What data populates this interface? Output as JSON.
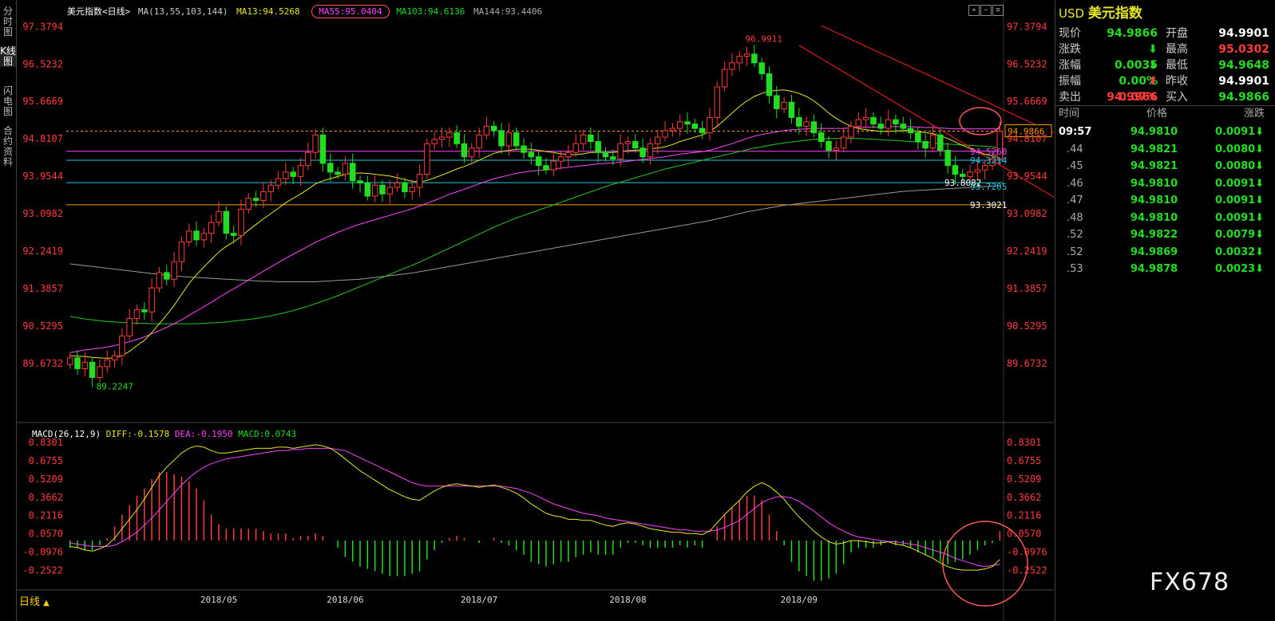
{
  "sidebar": [
    {
      "label": "分时图",
      "active": false
    },
    {
      "label": "K线图",
      "active": true
    },
    {
      "label": "闪电图",
      "active": false
    },
    {
      "label": "合约资料",
      "active": false
    }
  ],
  "header": {
    "name": "美元指数<日线>",
    "ma_params": "MA(13,55,103,144)",
    "ma13": "MA13:94.5268",
    "ma55": "MA55:95.0404",
    "ma103": "MA103:94.6136",
    "ma144": "MA144:93.4406"
  },
  "macd_header": {
    "params": "MACD(26,12,9)",
    "diff": "DIFF:-0.1578",
    "dea": "DEA:-0.1950",
    "macd": "MACD:0.0743"
  },
  "period_label": "日线",
  "watermark": "FX678",
  "colors": {
    "up": "#ff3b3b",
    "down": "#22dd22",
    "ma13": "#e8e820",
    "ma55": "#ff44ff",
    "ma103": "#22cc22",
    "ma144": "#999999",
    "axis": "#ff3b3b",
    "cyan": "#20c8e0"
  },
  "chart_data": [
    {
      "type": "candlestick",
      "title": "美元指数<日线>",
      "y_ticks": [
        "97.3794",
        "96.5232",
        "95.6669",
        "94.8107",
        "93.9544",
        "93.0982",
        "92.2419",
        "91.3857",
        "90.5295",
        "89.6732"
      ],
      "y_range": [
        89.05,
        97.55
      ],
      "x_ticks": [
        "2018/05",
        "2018/06",
        "2018/07",
        "2018/08",
        "2018/09"
      ],
      "high_label": "96.9911",
      "low_label": "89.2247",
      "price_tag": "94.9866",
      "level_labels": [
        {
          "text": "94.5260",
          "value": 94.526,
          "color": "#ff44ff"
        },
        {
          "text": "94.3214",
          "value": 94.3214,
          "color": "#20c8e0"
        },
        {
          "text": "93.7205",
          "value": 93.7205,
          "color": "#20c8e0"
        },
        {
          "text": "93.8082",
          "value": 93.8082,
          "color": "#ffffff"
        },
        {
          "text": "93.3021",
          "value": 93.3021,
          "color": "#ffffff"
        }
      ],
      "horizontal_lines": [
        {
          "value": 94.9866,
          "color": "#ff9900",
          "dashed": true
        },
        {
          "value": 94.526,
          "color": "#ff44ff",
          "dashed": false
        },
        {
          "value": 94.3214,
          "color": "#20c8e0",
          "dashed": false
        },
        {
          "value": 93.8082,
          "color": "#20c8e0",
          "dashed": false
        },
        {
          "value": 93.3021,
          "color": "#ff9900",
          "dashed": false
        }
      ],
      "closes": [
        89.8,
        89.55,
        89.7,
        89.35,
        89.6,
        89.75,
        89.85,
        90.3,
        90.7,
        90.9,
        90.85,
        91.4,
        91.75,
        91.6,
        92.0,
        92.45,
        92.7,
        92.5,
        92.65,
        92.9,
        93.15,
        92.65,
        92.6,
        93.2,
        93.45,
        93.4,
        93.6,
        93.75,
        93.9,
        94.05,
        93.95,
        94.2,
        94.5,
        94.9,
        94.25,
        94.05,
        94.0,
        94.25,
        93.85,
        93.8,
        93.5,
        93.75,
        93.55,
        93.7,
        93.8,
        93.6,
        93.7,
        94.0,
        94.7,
        94.8,
        94.85,
        94.95,
        94.7,
        94.4,
        94.6,
        94.9,
        95.1,
        95.0,
        94.65,
        94.95,
        94.65,
        94.5,
        94.4,
        94.2,
        94.1,
        94.3,
        94.4,
        94.5,
        94.7,
        94.9,
        94.75,
        94.5,
        94.4,
        94.35,
        94.7,
        94.75,
        94.6,
        94.4,
        94.7,
        94.85,
        95.0,
        95.05,
        95.2,
        95.15,
        95.05,
        94.95,
        95.3,
        96.0,
        96.4,
        96.55,
        96.7,
        96.75,
        96.55,
        96.3,
        95.8,
        95.5,
        95.65,
        95.3,
        95.1,
        95.2,
        94.95,
        94.75,
        94.55,
        94.6,
        94.85,
        95.1,
        95.25,
        95.3,
        95.15,
        95.05,
        95.25,
        95.15,
        95.05,
        94.95,
        94.75,
        94.6,
        94.9,
        94.55,
        94.2,
        94.0,
        93.95,
        94.05,
        94.1,
        94.2,
        94.35,
        94.9866
      ],
      "ma13": [
        89.85,
        89.84,
        89.83,
        89.81,
        89.8,
        89.79,
        89.8,
        89.85,
        89.95,
        90.08,
        90.2,
        90.38,
        90.58,
        90.78,
        91.0,
        91.25,
        91.5,
        91.7,
        91.88,
        92.05,
        92.22,
        92.35,
        92.45,
        92.58,
        92.72,
        92.85,
        92.98,
        93.1,
        93.22,
        93.35,
        93.45,
        93.55,
        93.66,
        93.78,
        93.85,
        93.9,
        93.95,
        94.0,
        94.02,
        94.03,
        94.02,
        94.0,
        93.98,
        93.96,
        93.92,
        93.88,
        93.84,
        93.82,
        93.86,
        93.92,
        93.98,
        94.05,
        94.12,
        94.18,
        94.25,
        94.32,
        94.4,
        94.48,
        94.52,
        94.55,
        94.57,
        94.58,
        94.57,
        94.55,
        94.52,
        94.5,
        94.47,
        94.45,
        94.45,
        94.47,
        94.5,
        94.5,
        94.5,
        94.5,
        94.52,
        94.54,
        94.55,
        94.56,
        94.58,
        94.6,
        94.63,
        94.68,
        94.75,
        94.8,
        94.85,
        94.9,
        94.98,
        95.1,
        95.25,
        95.4,
        95.55,
        95.68,
        95.78,
        95.85,
        95.9,
        95.92,
        95.93,
        95.9,
        95.85,
        95.78,
        95.68,
        95.55,
        95.4,
        95.28,
        95.18,
        95.1,
        95.05,
        95.02,
        95.0,
        94.98,
        94.98,
        94.99,
        95.0,
        95.0,
        94.98,
        94.95,
        94.93,
        94.88,
        94.82,
        94.74,
        94.66,
        94.59,
        94.52,
        94.46,
        94.42,
        94.4
      ],
      "ma55": [
        89.92,
        89.95,
        89.98,
        90.0,
        90.02,
        90.05,
        90.08,
        90.12,
        90.17,
        90.22,
        90.28,
        90.35,
        90.42,
        90.5,
        90.58,
        90.67,
        90.77,
        90.87,
        90.97,
        91.07,
        91.18,
        91.28,
        91.38,
        91.48,
        91.58,
        91.68,
        91.78,
        91.88,
        91.98,
        92.08,
        92.17,
        92.26,
        92.35,
        92.44,
        92.52,
        92.6,
        92.67,
        92.74,
        92.8,
        92.86,
        92.91,
        92.96,
        93.01,
        93.06,
        93.11,
        93.16,
        93.21,
        93.27,
        93.34,
        93.4,
        93.47,
        93.54,
        93.6,
        93.66,
        93.72,
        93.78,
        93.84,
        93.9,
        93.94,
        93.98,
        94.02,
        94.05,
        94.07,
        94.09,
        94.1,
        94.12,
        94.14,
        94.16,
        94.18,
        94.2,
        94.22,
        94.24,
        94.25,
        94.26,
        94.28,
        94.3,
        94.32,
        94.34,
        94.36,
        94.38,
        94.4,
        94.43,
        94.46,
        94.48,
        94.5,
        94.52,
        94.55,
        94.6,
        94.65,
        94.7,
        94.76,
        94.82,
        94.87,
        94.91,
        94.94,
        94.97,
        95.0,
        95.02,
        95.03,
        95.04,
        95.05,
        95.05,
        95.05,
        95.05,
        95.05,
        95.06,
        95.07,
        95.08,
        95.08,
        95.08,
        95.09,
        95.09,
        95.09,
        95.09,
        95.08,
        95.07,
        95.07,
        95.06,
        95.05,
        95.04,
        95.04,
        95.04,
        95.04,
        95.04,
        95.04,
        95.04
      ],
      "ma103": [
        90.75,
        90.72,
        90.69,
        90.67,
        90.65,
        90.63,
        90.62,
        90.61,
        90.6,
        90.59,
        90.59,
        90.58,
        90.58,
        90.58,
        90.58,
        90.58,
        90.58,
        90.58,
        90.59,
        90.6,
        90.61,
        90.62,
        90.64,
        90.66,
        90.68,
        90.7,
        90.73,
        90.76,
        90.8,
        90.84,
        90.88,
        90.93,
        90.98,
        91.04,
        91.1,
        91.16,
        91.22,
        91.29,
        91.36,
        91.43,
        91.5,
        91.57,
        91.64,
        91.71,
        91.78,
        91.85,
        91.92,
        91.99,
        92.07,
        92.15,
        92.23,
        92.31,
        92.39,
        92.47,
        92.55,
        92.63,
        92.71,
        92.79,
        92.86,
        92.93,
        93.0,
        93.06,
        93.12,
        93.18,
        93.24,
        93.3,
        93.36,
        93.42,
        93.48,
        93.54,
        93.6,
        93.66,
        93.72,
        93.77,
        93.82,
        93.87,
        93.92,
        93.97,
        94.02,
        94.07,
        94.12,
        94.16,
        94.2,
        94.24,
        94.28,
        94.32,
        94.36,
        94.4,
        94.44,
        94.48,
        94.52,
        94.56,
        94.6,
        94.63,
        94.66,
        94.69,
        94.72,
        94.74,
        94.76,
        94.78,
        94.8,
        94.81,
        94.82,
        94.82,
        94.82,
        94.82,
        94.82,
        94.81,
        94.8,
        94.79,
        94.78,
        94.77,
        94.76,
        94.75,
        94.74,
        94.73,
        94.72,
        94.7,
        94.69,
        94.68,
        94.67,
        94.66,
        94.65,
        94.64,
        94.63,
        94.61
      ],
      "ma144": [
        91.95,
        91.93,
        91.91,
        91.89,
        91.87,
        91.85,
        91.83,
        91.81,
        91.79,
        91.77,
        91.75,
        91.73,
        91.71,
        91.69,
        91.67,
        91.66,
        91.65,
        91.64,
        91.63,
        91.62,
        91.61,
        91.6,
        91.59,
        91.58,
        91.57,
        91.56,
        91.55,
        91.55,
        91.54,
        91.54,
        91.54,
        91.54,
        91.54,
        91.54,
        91.55,
        91.56,
        91.57,
        91.58,
        91.59,
        91.6,
        91.62,
        91.64,
        91.66,
        91.68,
        91.7,
        91.72,
        91.74,
        91.77,
        91.8,
        91.83,
        91.86,
        91.89,
        91.92,
        91.95,
        91.98,
        92.01,
        92.04,
        92.07,
        92.1,
        92.13,
        92.16,
        92.19,
        92.22,
        92.25,
        92.28,
        92.31,
        92.34,
        92.37,
        92.4,
        92.43,
        92.46,
        92.49,
        92.52,
        92.55,
        92.58,
        92.61,
        92.64,
        92.67,
        92.7,
        92.73,
        92.76,
        92.79,
        92.82,
        92.85,
        92.88,
        92.91,
        92.94,
        92.98,
        93.02,
        93.06,
        93.1,
        93.14,
        93.17,
        93.2,
        93.23,
        93.26,
        93.29,
        93.31,
        93.33,
        93.35,
        93.37,
        93.39,
        93.41,
        93.43,
        93.45,
        93.47,
        93.49,
        93.51,
        93.53,
        93.55,
        93.57,
        93.59,
        93.61,
        93.62,
        93.63,
        93.64,
        93.65,
        93.66,
        93.67,
        93.68,
        93.69,
        93.7,
        93.71,
        93.72,
        93.73,
        93.74
      ],
      "trend_channel": [
        {
          "from": [
            96.95,
            98
          ],
          "to": [
            93.1,
            136
          ]
        },
        {
          "from": [
            97.4,
            101
          ],
          "to": [
            94.65,
            136
          ]
        }
      ]
    },
    {
      "type": "macd",
      "title": "MACD(26,12,9)",
      "y_ticks": [
        "0.8301",
        "0.6755",
        "0.5209",
        "0.3662",
        "0.2116",
        "0.0570",
        "-0.0976",
        "-0.2522"
      ],
      "y_range": [
        -0.33,
        0.85
      ],
      "diff": [
        -0.05,
        -0.06,
        -0.08,
        -0.09,
        -0.07,
        -0.04,
        0.02,
        0.1,
        0.18,
        0.26,
        0.35,
        0.45,
        0.55,
        0.62,
        0.68,
        0.74,
        0.78,
        0.8,
        0.79,
        0.76,
        0.74,
        0.74,
        0.75,
        0.76,
        0.77,
        0.78,
        0.78,
        0.78,
        0.79,
        0.79,
        0.78,
        0.79,
        0.8,
        0.81,
        0.8,
        0.78,
        0.74,
        0.69,
        0.64,
        0.59,
        0.55,
        0.51,
        0.47,
        0.43,
        0.4,
        0.37,
        0.35,
        0.34,
        0.38,
        0.42,
        0.45,
        0.47,
        0.48,
        0.47,
        0.46,
        0.45,
        0.46,
        0.47,
        0.45,
        0.43,
        0.4,
        0.36,
        0.31,
        0.27,
        0.23,
        0.21,
        0.2,
        0.18,
        0.18,
        0.17,
        0.17,
        0.15,
        0.13,
        0.12,
        0.14,
        0.15,
        0.14,
        0.12,
        0.1,
        0.09,
        0.08,
        0.07,
        0.07,
        0.06,
        0.06,
        0.05,
        0.08,
        0.15,
        0.22,
        0.28,
        0.34,
        0.41,
        0.46,
        0.49,
        0.46,
        0.41,
        0.35,
        0.27,
        0.2,
        0.14,
        0.08,
        0.03,
        -0.01,
        -0.03,
        -0.02,
        0.0,
        0.0,
        -0.01,
        -0.02,
        -0.02,
        -0.01,
        -0.03,
        -0.04,
        -0.06,
        -0.09,
        -0.12,
        -0.15,
        -0.19,
        -0.22,
        -0.24,
        -0.25,
        -0.25,
        -0.25,
        -0.24,
        -0.22,
        -0.16
      ],
      "dea": [
        -0.02,
        -0.03,
        -0.04,
        -0.05,
        -0.05,
        -0.05,
        -0.04,
        -0.01,
        0.03,
        0.07,
        0.13,
        0.19,
        0.26,
        0.33,
        0.4,
        0.47,
        0.53,
        0.58,
        0.62,
        0.65,
        0.67,
        0.69,
        0.7,
        0.71,
        0.72,
        0.73,
        0.74,
        0.75,
        0.76,
        0.76,
        0.77,
        0.77,
        0.78,
        0.78,
        0.78,
        0.78,
        0.77,
        0.76,
        0.73,
        0.7,
        0.67,
        0.64,
        0.61,
        0.58,
        0.55,
        0.52,
        0.49,
        0.47,
        0.46,
        0.46,
        0.46,
        0.46,
        0.46,
        0.46,
        0.46,
        0.46,
        0.46,
        0.46,
        0.46,
        0.45,
        0.44,
        0.42,
        0.4,
        0.37,
        0.34,
        0.31,
        0.29,
        0.27,
        0.25,
        0.23,
        0.22,
        0.21,
        0.19,
        0.18,
        0.17,
        0.16,
        0.15,
        0.14,
        0.13,
        0.12,
        0.11,
        0.1,
        0.09,
        0.09,
        0.08,
        0.08,
        0.08,
        0.09,
        0.11,
        0.14,
        0.17,
        0.22,
        0.27,
        0.32,
        0.35,
        0.37,
        0.37,
        0.36,
        0.33,
        0.29,
        0.25,
        0.2,
        0.15,
        0.11,
        0.08,
        0.05,
        0.03,
        0.02,
        0.01,
        0.0,
        -0.01,
        -0.01,
        -0.02,
        -0.03,
        -0.04,
        -0.06,
        -0.08,
        -0.1,
        -0.12,
        -0.15,
        -0.17,
        -0.19,
        -0.21,
        -0.22,
        -0.21,
        -0.2
      ]
    }
  ],
  "quote": {
    "currency": "USD",
    "name": "美元指数",
    "rows": [
      {
        "k1": "现价",
        "v1": "94.9866",
        "c1": "dn",
        "k2": "开盘",
        "v2": "94.9901",
        "c2": "wt"
      },
      {
        "k1": "涨跌",
        "v1": "0.0035",
        "c1": "dn",
        "a1": "down",
        "k2": "最高",
        "v2": "95.0302",
        "c2": "up"
      },
      {
        "k1": "涨幅",
        "v1": "0.00%",
        "c1": "dn",
        "a1": "down",
        "k2": "最低",
        "v2": "94.9648",
        "c2": "dn"
      },
      {
        "k1": "振幅",
        "v1": "0.07%",
        "c1": "up",
        "a1": "up",
        "k2": "昨收",
        "v2": "94.9901",
        "c2": "wt"
      },
      {
        "k1": "卖出",
        "v1": "94.9966",
        "c1": "up",
        "k2": "买入",
        "v2": "94.9866",
        "c2": "dn"
      }
    ],
    "tick_headers": [
      "时间",
      "价格",
      "涨跌"
    ],
    "ticks": [
      {
        "time": "09:57",
        "price": "94.9810",
        "chg": "0.0091"
      },
      {
        "time": ".44",
        "price": "94.9821",
        "chg": "0.0080"
      },
      {
        "time": ".45",
        "price": "94.9821",
        "chg": "0.0080"
      },
      {
        "time": ".46",
        "price": "94.9810",
        "chg": "0.0091"
      },
      {
        "time": ".47",
        "price": "94.9810",
        "chg": "0.0091"
      },
      {
        "time": ".48",
        "price": "94.9810",
        "chg": "0.0091"
      },
      {
        "time": ".52",
        "price": "94.9822",
        "chg": "0.0079"
      },
      {
        "time": ".52",
        "price": "94.9869",
        "chg": "0.0032"
      },
      {
        "time": ".53",
        "price": "94.9878",
        "chg": "0.0023"
      }
    ]
  }
}
